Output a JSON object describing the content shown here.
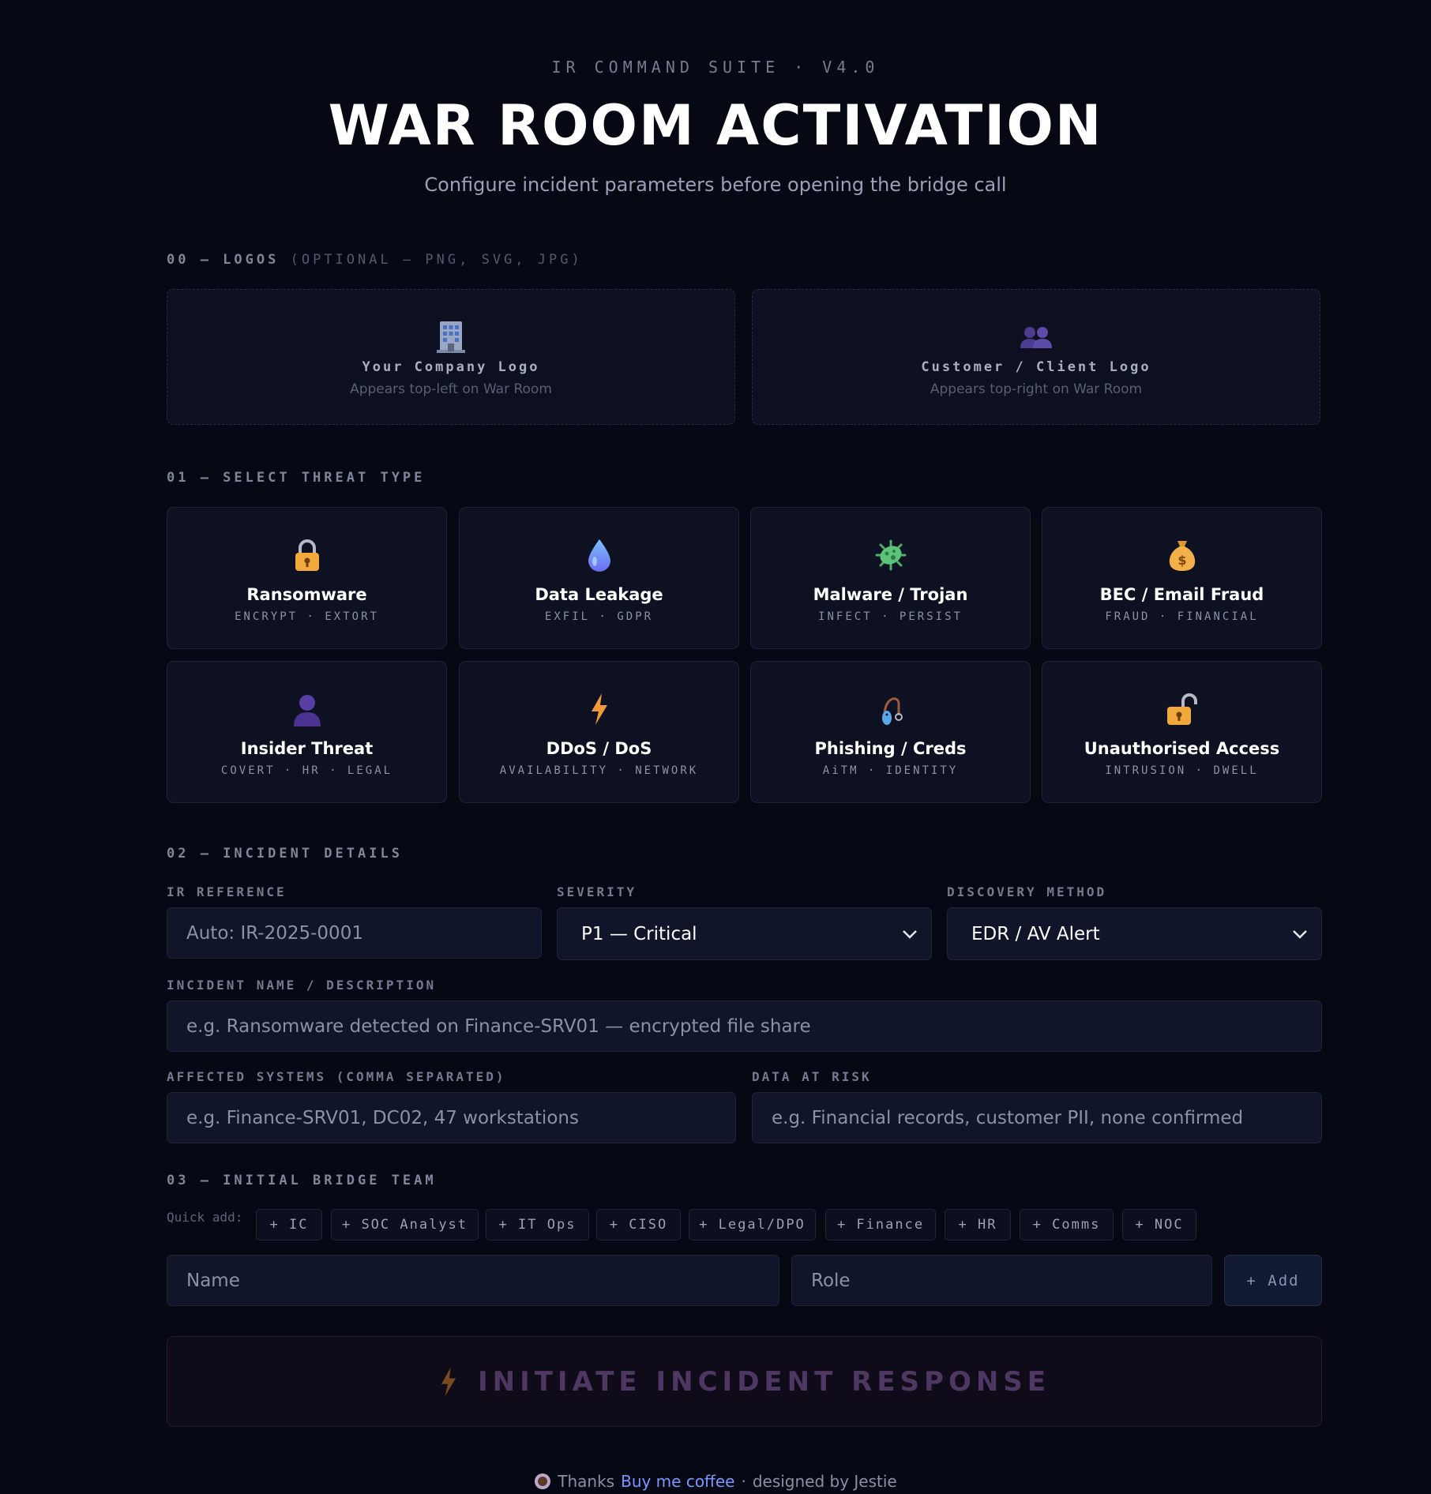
{
  "header": {
    "eyebrow": "IR COMMAND SUITE · V4.0",
    "title": "WAR ROOM ACTIVATION",
    "subtitle": "Configure incident parameters before opening the bridge call"
  },
  "logos": {
    "section_label": "00 — LOGOS",
    "section_hint": "(OPTIONAL — PNG, SVG, JPG)",
    "company": {
      "icon": "office-building-icon",
      "title": "Your Company Logo",
      "subtitle": "Appears top-left on War Room"
    },
    "customer": {
      "icon": "people-icon",
      "title": "Customer / Client Logo",
      "subtitle": "Appears top-right on War Room"
    }
  },
  "threats": {
    "section_label": "01 — SELECT THREAT TYPE",
    "items": [
      {
        "name": "Ransomware",
        "tags": "ENCRYPT · EXTORT",
        "icon": "lock-icon"
      },
      {
        "name": "Data Leakage",
        "tags": "EXFIL · GDPR",
        "icon": "droplet-icon"
      },
      {
        "name": "Malware / Trojan",
        "tags": "INFECT · PERSIST",
        "icon": "microbe-icon"
      },
      {
        "name": "BEC / Email Fraud",
        "tags": "FRAUD · FINANCIAL",
        "icon": "money-bag-icon"
      },
      {
        "name": "Insider Threat",
        "tags": "COVERT · HR · LEGAL",
        "icon": "person-silhouette-icon"
      },
      {
        "name": "DDoS / DoS",
        "tags": "AVAILABILITY · NETWORK",
        "icon": "lightning-icon"
      },
      {
        "name": "Phishing / Creds",
        "tags": "AiTM · IDENTITY",
        "icon": "fishing-hook-icon"
      },
      {
        "name": "Unauthorised Access",
        "tags": "INTRUSION · DWELL",
        "icon": "unlocked-icon"
      }
    ]
  },
  "details": {
    "section_label": "02 — INCIDENT DETAILS",
    "ir_reference": {
      "label": "IR REFERENCE",
      "placeholder": "Auto: IR-2025-0001"
    },
    "severity": {
      "label": "SEVERITY",
      "value": "P1 — Critical"
    },
    "discovery": {
      "label": "DISCOVERY METHOD",
      "value": "EDR / AV Alert"
    },
    "incident_name": {
      "label": "INCIDENT NAME / DESCRIPTION",
      "placeholder": "e.g. Ransomware detected on Finance-SRV01 — encrypted file share"
    },
    "affected_systems": {
      "label": "AFFECTED SYSTEMS (COMMA SEPARATED)",
      "placeholder": "e.g. Finance-SRV01, DC02, 47 workstations"
    },
    "data_at_risk": {
      "label": "DATA AT RISK",
      "placeholder": "e.g. Financial records, customer PII, none confirmed"
    }
  },
  "team": {
    "section_label": "03 — INITIAL BRIDGE TEAM",
    "quick_add_label": "Quick add:",
    "chips": [
      "+ IC",
      "+ SOC Analyst",
      "+ IT Ops",
      "+ CISO",
      "+ Legal/DPO",
      "+ Finance",
      "+ HR",
      "+ Comms",
      "+ NOC"
    ],
    "name_placeholder": "Name",
    "role_placeholder": "Role",
    "add_label": "+ Add"
  },
  "cta": {
    "label": "INITIATE INCIDENT RESPONSE",
    "icon": "lightning-icon"
  },
  "footer": {
    "icon": "coffee-icon",
    "thanks": "Thanks",
    "link": "Buy me coffee",
    "separator": "·",
    "credit": "designed by Jestie"
  },
  "colors": {
    "background": "#060913",
    "card": "#0d1121",
    "link": "#7b96ff",
    "cta_text": "#4f3763"
  }
}
